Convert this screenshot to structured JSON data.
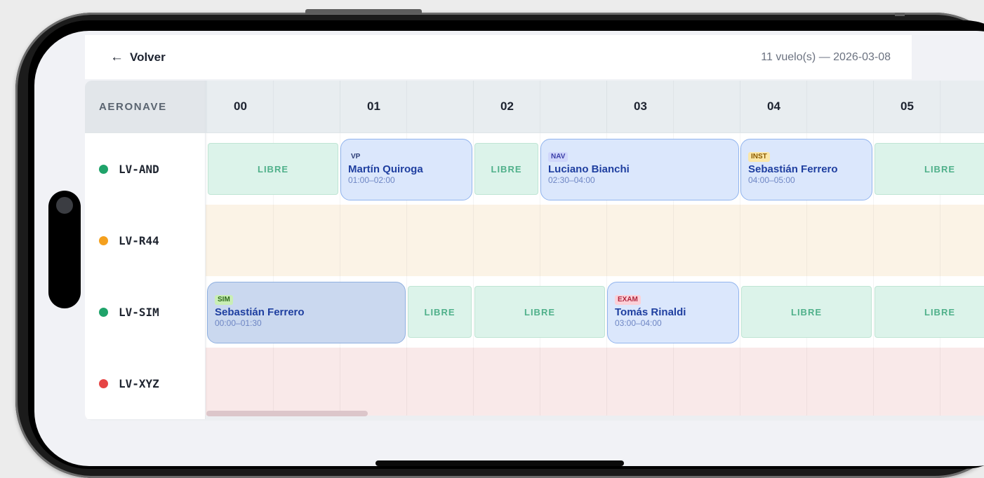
{
  "topbar": {
    "back_label": "Volver",
    "back_icon": "arrow-left-icon",
    "summary": "11 vuelo(s) — 2026-03-08"
  },
  "grid": {
    "aircraft_header": "AERONAVE",
    "hours": [
      "00",
      "01",
      "02",
      "03",
      "04",
      "05"
    ]
  },
  "status_colors": {
    "ok": "#1fa36a",
    "warn": "#f4a01e",
    "down": "#e64545"
  },
  "rows": [
    {
      "aircraft": "LV-AND",
      "status": "ok",
      "row_color": "#ffffff",
      "slots": [
        {
          "type": "free",
          "label": "LIBRE",
          "start": "00:00",
          "end": "01:00"
        },
        {
          "type": "flight",
          "tag": "VP",
          "pilot": "Martín Quiroga",
          "time": "01:00–02:00",
          "start": "01:00",
          "end": "02:00"
        },
        {
          "type": "free",
          "label": "LIBRE",
          "start": "02:00",
          "end": "02:30"
        },
        {
          "type": "flight",
          "tag": "NAV",
          "pilot": "Luciano Bianchi",
          "time": "02:30–04:00",
          "start": "02:30",
          "end": "04:00"
        },
        {
          "type": "flight",
          "tag": "INST",
          "pilot": "Sebastián Ferrero",
          "time": "04:00–05:00",
          "start": "04:00",
          "end": "05:00"
        },
        {
          "type": "free",
          "label": "LIBRE",
          "start": "05:00",
          "end": "06:00"
        }
      ]
    },
    {
      "aircraft": "LV-R44",
      "status": "warn",
      "row_color": "#fbf3e6",
      "slots": []
    },
    {
      "aircraft": "LV-SIM",
      "status": "ok",
      "row_color": "#ffffff",
      "slots": [
        {
          "type": "flight",
          "tag": "SIM",
          "pilot": "Sebastián Ferrero",
          "time": "00:00–01:30",
          "start": "00:00",
          "end": "01:30"
        },
        {
          "type": "free",
          "label": "LIBRE",
          "start": "01:30",
          "end": "02:00"
        },
        {
          "type": "free",
          "label": "LIBRE",
          "start": "02:00",
          "end": "03:00"
        },
        {
          "type": "flight",
          "tag": "EXAM",
          "pilot": "Tomás Rinaldi",
          "time": "03:00–04:00",
          "start": "03:00",
          "end": "04:00"
        },
        {
          "type": "free",
          "label": "LIBRE",
          "start": "04:00",
          "end": "05:00"
        },
        {
          "type": "free",
          "label": "LIBRE",
          "start": "05:00",
          "end": "06:00"
        }
      ]
    },
    {
      "aircraft": "LV-XYZ",
      "status": "down",
      "row_color": "#f9e9e9",
      "slots": []
    }
  ],
  "tag_styles": {
    "VP": {
      "bg": "#dbe7fc",
      "fg": "#2b3b74"
    },
    "NAV": {
      "bg": "#cfd6fb",
      "fg": "#3b3fa8"
    },
    "INST": {
      "bg": "#fbe7a8",
      "fg": "#8a5a00"
    },
    "SIM": {
      "bg": "#c9eeb5",
      "fg": "#2f6b1d"
    },
    "EXAM": {
      "bg": "#fbd0d8",
      "fg": "#b0263e"
    }
  }
}
